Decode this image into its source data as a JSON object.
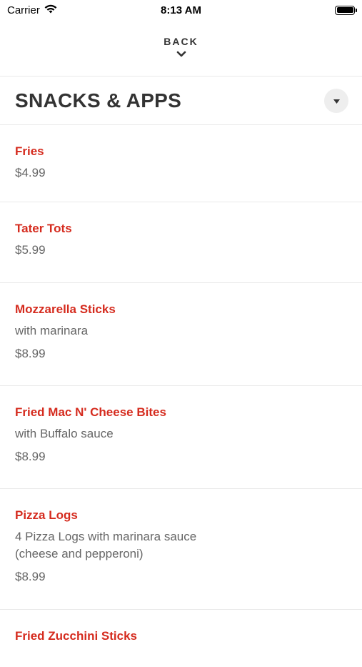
{
  "status_bar": {
    "carrier": "Carrier",
    "time": "8:13 AM"
  },
  "nav": {
    "back_label": "BACK"
  },
  "section": {
    "title": "SNACKS & APPS"
  },
  "items": [
    {
      "name": "Fries",
      "description": "",
      "price": "$4.99"
    },
    {
      "name": "Tater Tots",
      "description": "",
      "price": "$5.99"
    },
    {
      "name": "Mozzarella Sticks",
      "description": "with marinara",
      "price": "$8.99"
    },
    {
      "name": "Fried Mac N' Cheese Bites",
      "description": "with Buffalo sauce",
      "price": "$8.99"
    },
    {
      "name": "Pizza Logs",
      "description": "4 Pizza Logs with marinara sauce (cheese and pepperoni)",
      "price": "$8.99"
    },
    {
      "name": "Fried Zucchini Sticks",
      "description": "",
      "price": ""
    }
  ],
  "colors": {
    "item_name": "#d52b1e",
    "text_muted": "#666666",
    "title": "#333333"
  },
  "icons": {
    "wifi": "wifi-icon",
    "battery": "battery-icon",
    "back": "chevron-down-icon",
    "dropdown": "caret-down-icon"
  }
}
